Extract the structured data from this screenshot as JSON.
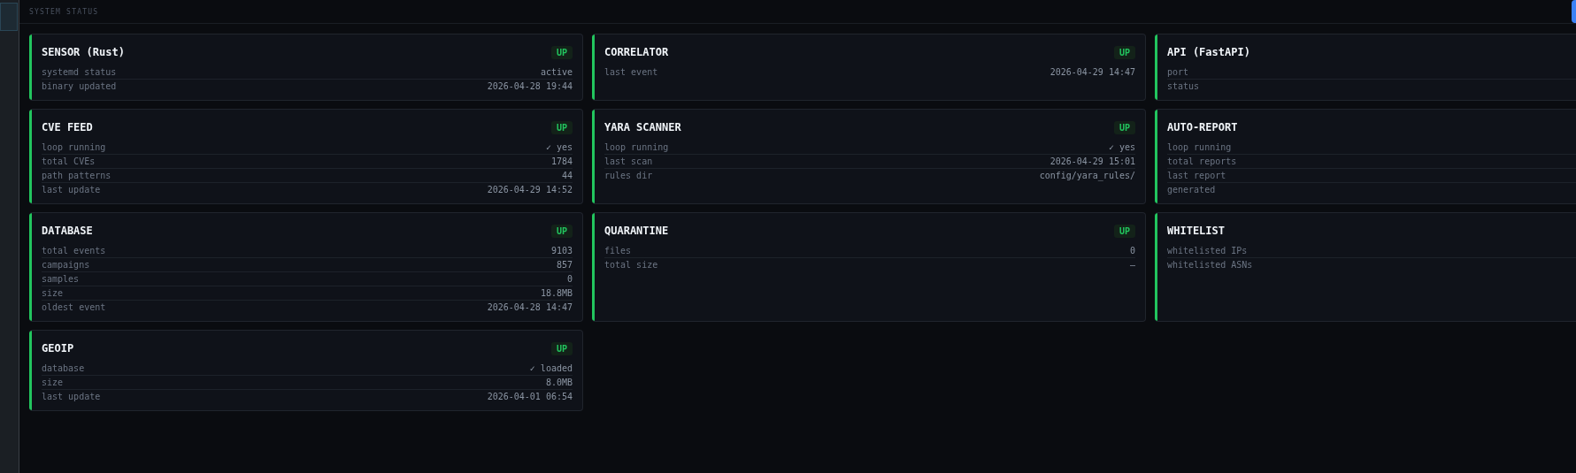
{
  "header": {
    "title": "SYSTEM STATUS"
  },
  "cards": [
    {
      "name": "SENSOR (Rust)",
      "color": "#22c55e",
      "badge": "UP",
      "rows": [
        {
          "label": "systemd status",
          "value": "active"
        },
        {
          "label": "binary updated",
          "value": "2026-04-28 19:44"
        }
      ]
    },
    {
      "name": "CORRELATOR",
      "color": "#22c55e",
      "badge": "UP",
      "rows": [
        {
          "label": "last event",
          "value": "2026-04-29 14:47"
        }
      ]
    },
    {
      "name": "API (FastAPI)",
      "color": "#22c55e",
      "rows": [
        {
          "label": "port"
        },
        {
          "label": "status"
        }
      ]
    },
    {
      "name": "CVE FEED",
      "color": "#22c55e",
      "badge": "UP",
      "rows": [
        {
          "label": "loop running",
          "value": "✓ yes"
        },
        {
          "label": "total CVEs",
          "value": "1784"
        },
        {
          "label": "path patterns",
          "value": "44"
        },
        {
          "label": "last update",
          "value": "2026-04-29 14:52"
        }
      ]
    },
    {
      "name": "YARA SCANNER",
      "color": "#22c55e",
      "badge": "UP",
      "rows": [
        {
          "label": "loop running",
          "value": "✓ yes"
        },
        {
          "label": "last scan",
          "value": "2026-04-29 15:01"
        },
        {
          "label": "rules dir",
          "value": "config/yara_rules/"
        }
      ]
    },
    {
      "name": "AUTO-REPORT",
      "color": "#22c55e",
      "rows": [
        {
          "label": "loop running"
        },
        {
          "label": "total reports"
        },
        {
          "label": "last report"
        },
        {
          "label": "generated"
        }
      ]
    },
    {
      "name": "DATABASE",
      "color": "#22c55e",
      "badge": "UP",
      "rows": [
        {
          "label": "total events",
          "value": "9103"
        },
        {
          "label": "campaigns",
          "value": "857"
        },
        {
          "label": "samples",
          "value": "0"
        },
        {
          "label": "size",
          "value": "18.8MB"
        },
        {
          "label": "oldest event",
          "value": "2026-04-28 14:47"
        }
      ]
    },
    {
      "name": "QUARANTINE",
      "color": "#22c55e",
      "badge": "UP",
      "rows": [
        {
          "label": "files",
          "value": "0"
        },
        {
          "label": "total size",
          "value": "—"
        }
      ]
    },
    {
      "name": "WHITELIST",
      "color": "#22c55e",
      "rows": [
        {
          "label": "whitelisted IPs"
        },
        {
          "label": "whitelisted ASNs"
        }
      ]
    },
    {
      "name": "GEOIP",
      "color": "#22c55e",
      "badge": "UP",
      "rows": [
        {
          "label": "database",
          "value": "✓ loaded"
        },
        {
          "label": "size",
          "value": "8.0MB"
        },
        {
          "label": "last update",
          "value": "2026-04-01 06:54"
        }
      ]
    }
  ]
}
